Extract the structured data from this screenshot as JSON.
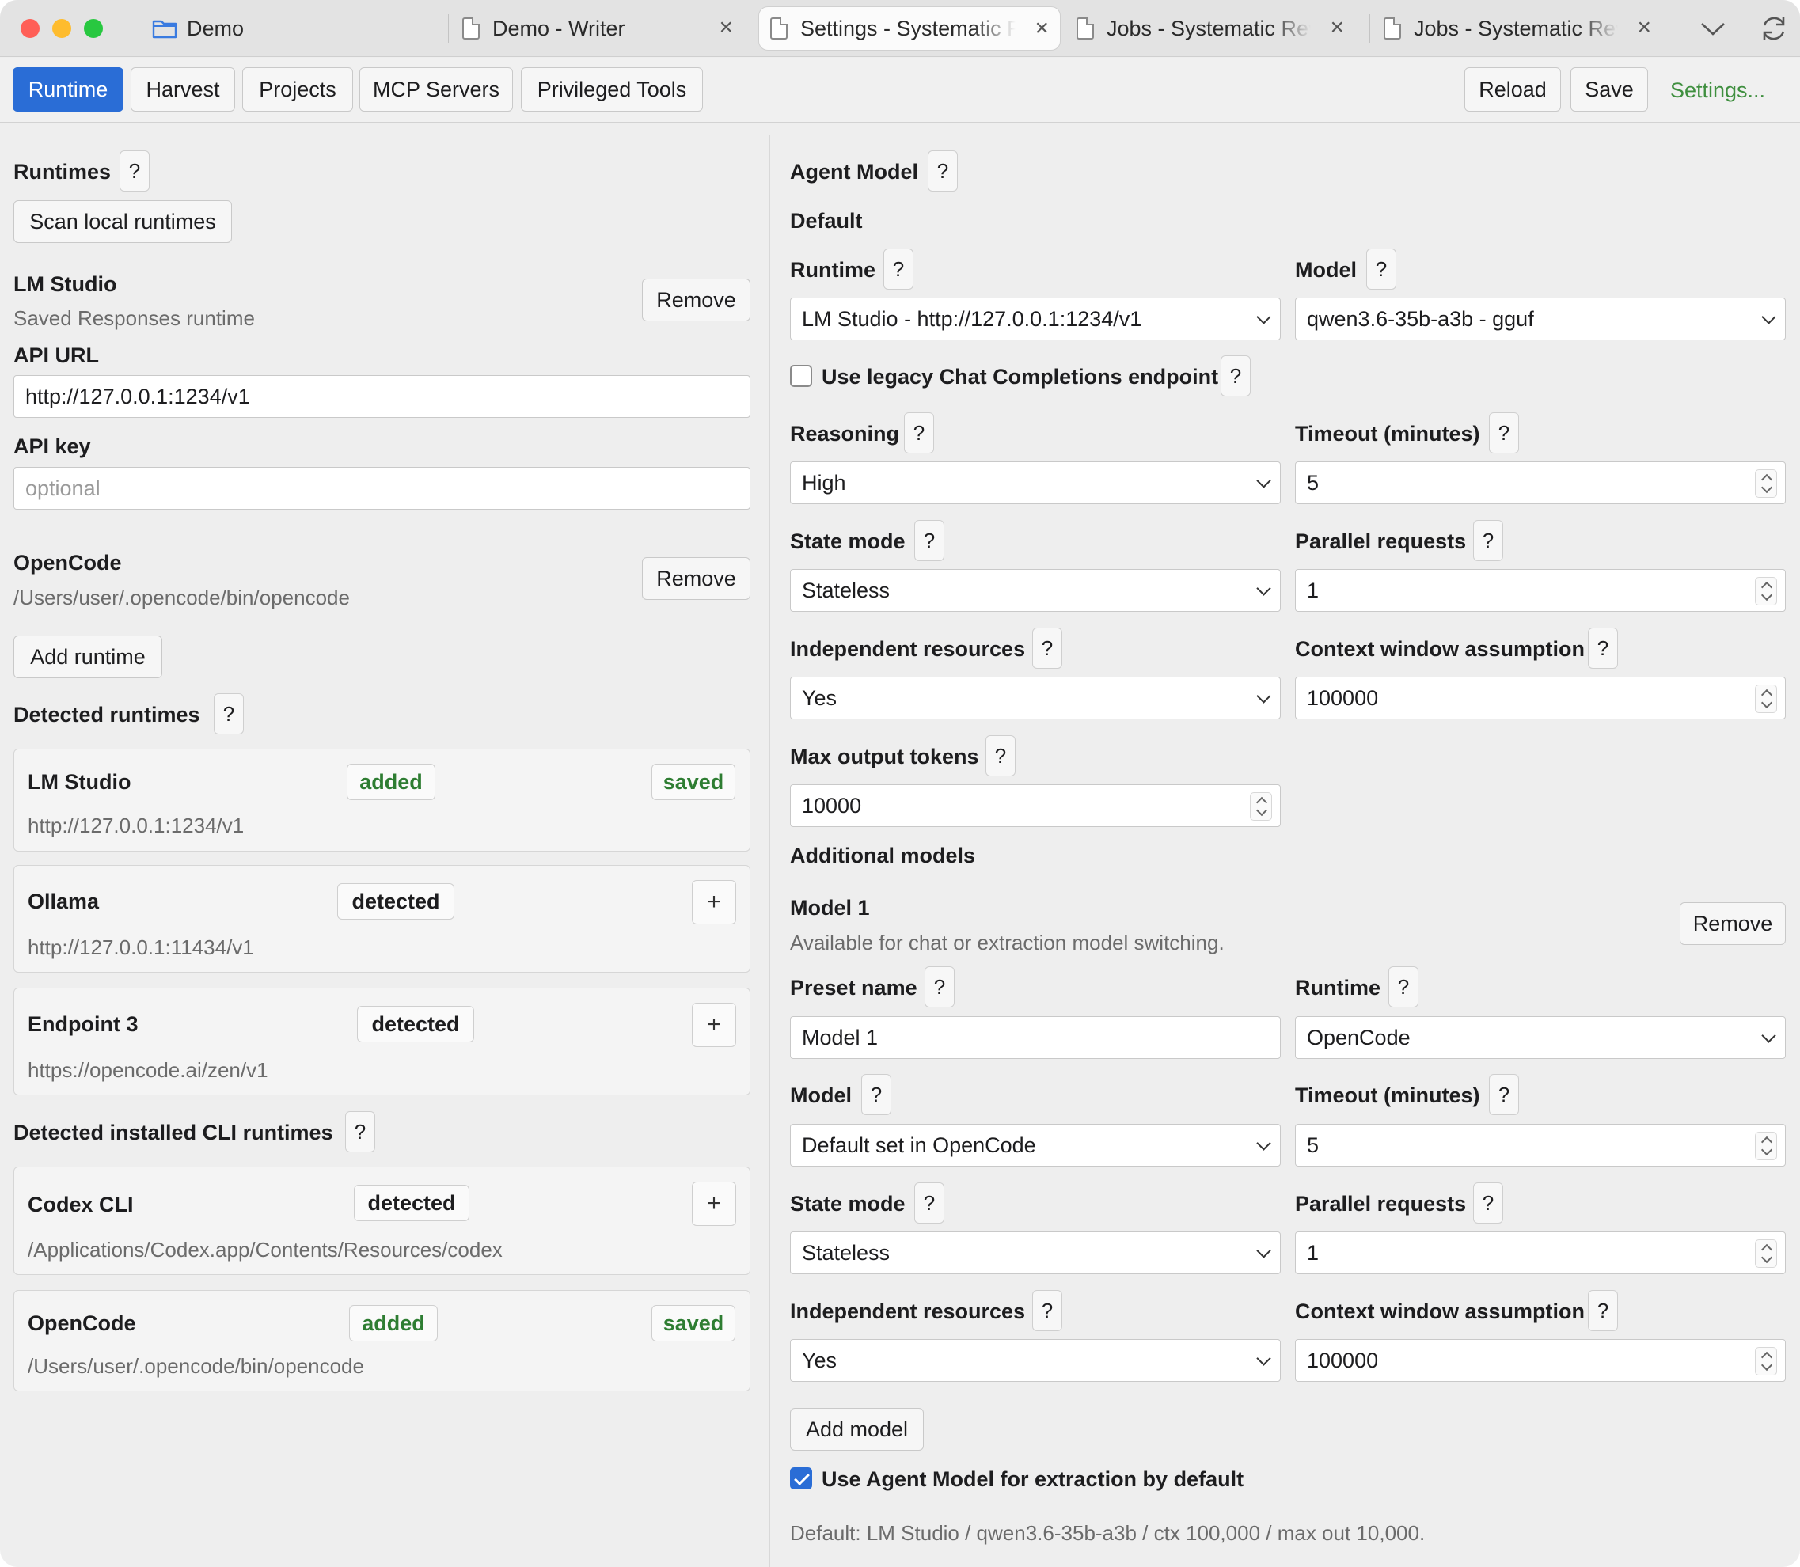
{
  "window": {
    "tabs": [
      {
        "title": "Demo",
        "icon": "folder-icon"
      },
      {
        "title": "Demo - Writer",
        "icon": "document-icon"
      },
      {
        "title": "Settings - Systematic Review",
        "icon": "document-icon"
      },
      {
        "title": "Jobs - Systematic Review",
        "icon": "document-icon"
      },
      {
        "title": "Jobs - Systematic Review",
        "icon": "document-icon"
      }
    ],
    "close_glyph": "×"
  },
  "toolbar": {
    "tabs": [
      "Runtime",
      "Harvest",
      "Projects",
      "MCP Servers",
      "Privileged Tools"
    ],
    "active_tab": "Runtime",
    "reload_label": "Reload",
    "save_label": "Save",
    "settings_link": "Settings...",
    "accent_color": "#2a6dd6",
    "link_color": "#3f8f3f"
  },
  "left": {
    "runtimes_heading": "Runtimes",
    "help": "?",
    "scan_button": "Scan local runtimes",
    "lmstudio": {
      "name": "LM Studio",
      "subtitle": "Saved Responses runtime",
      "remove": "Remove",
      "api_url_label": "API URL",
      "api_url_value": "http://127.0.0.1:1234/v1",
      "api_key_label": "API key",
      "api_key_placeholder": "optional"
    },
    "opencode": {
      "name": "OpenCode",
      "path": "/Users/user/.opencode/bin/opencode",
      "remove": "Remove"
    },
    "add_runtime": "Add runtime",
    "detected_heading": "Detected runtimes",
    "detected": [
      {
        "name": "LM Studio",
        "status": "added",
        "extra": "saved",
        "url": "http://127.0.0.1:1234/v1"
      },
      {
        "name": "Ollama",
        "status": "detected",
        "url": "http://127.0.0.1:11434/v1"
      },
      {
        "name": "Endpoint 3",
        "status": "detected",
        "url": "https://opencode.ai/zen/v1"
      }
    ],
    "cli_heading": "Detected installed CLI runtimes",
    "cli": [
      {
        "name": "Codex CLI",
        "status": "detected",
        "path": "/Applications/Codex.app/Contents/Resources/codex"
      },
      {
        "name": "OpenCode",
        "status": "added",
        "extra": "saved",
        "path": "/Users/user/.opencode/bin/opencode"
      }
    ],
    "plus_glyph": "+"
  },
  "right": {
    "agent_heading": "Agent Model",
    "default_heading": "Default",
    "runtime_label": "Runtime",
    "runtime_value": "LM Studio - http://127.0.0.1:1234/v1",
    "model_label": "Model",
    "model_value": "qwen3.6-35b-a3b - gguf",
    "legacy_label": "Use legacy Chat Completions endpoint",
    "legacy_checked": false,
    "reasoning_label": "Reasoning",
    "reasoning_value": "High",
    "timeout_label": "Timeout (minutes)",
    "timeout_value": "5",
    "state_label": "State mode",
    "state_value": "Stateless",
    "parallel_label": "Parallel requests",
    "parallel_value": "1",
    "indep_label": "Independent resources",
    "indep_value": "Yes",
    "ctx_label": "Context window assumption",
    "ctx_value": "100000",
    "maxout_label": "Max output tokens",
    "maxout_value": "10000",
    "additional_heading": "Additional models",
    "model1": {
      "title": "Model 1",
      "desc": "Available for chat or extraction model switching.",
      "remove": "Remove",
      "preset_label": "Preset name",
      "preset_value": "Model 1",
      "runtime_label": "Runtime",
      "runtime_value": "OpenCode",
      "model_label": "Model",
      "model_value": "Default set in OpenCode",
      "timeout_label": "Timeout (minutes)",
      "timeout_value": "5",
      "state_label": "State mode",
      "state_value": "Stateless",
      "parallel_label": "Parallel requests",
      "parallel_value": "1",
      "indep_label": "Independent resources",
      "indep_value": "Yes",
      "ctx_label": "Context window assumption",
      "ctx_value": "100000"
    },
    "add_model": "Add model",
    "use_agent_label": "Use Agent Model for extraction by default",
    "use_agent_checked": true,
    "summary": "Default: LM Studio / qwen3.6-35b-a3b / ctx 100,000 / max out 10,000."
  }
}
